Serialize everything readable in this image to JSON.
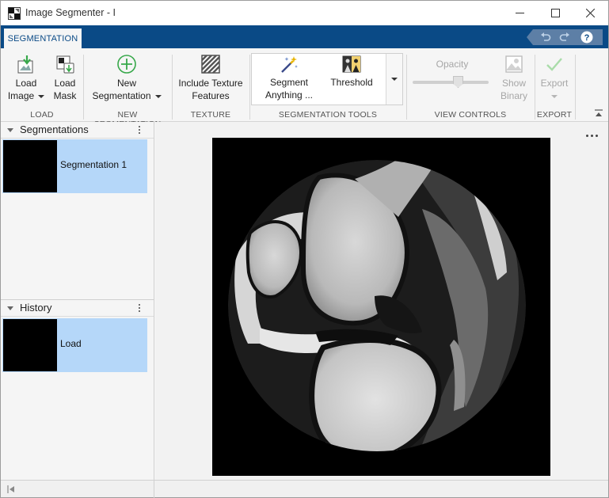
{
  "window": {
    "title": "Image Segmenter - I",
    "icon": "matlab-app-icon",
    "controls": [
      "minimize-icon",
      "maximize-icon",
      "close-icon"
    ]
  },
  "tabs": [
    {
      "label": "SEGMENTATION",
      "active": true
    }
  ],
  "quick_access": [
    "undo-icon",
    "redo-icon",
    "help-icon"
  ],
  "ribbon": {
    "load": {
      "group_label": "LOAD",
      "load_image": {
        "line1": "Load",
        "line2": "Image",
        "icon": "load-image-icon"
      },
      "load_mask": {
        "line1": "Load",
        "line2": "Mask",
        "icon": "load-mask-icon"
      }
    },
    "new_segmentation": {
      "group_label": "NEW SEGMENTATION",
      "button": {
        "line1": "New",
        "line2": "Segmentation",
        "icon": "plus-circle-icon"
      }
    },
    "texture": {
      "group_label": "TEXTURE",
      "button": {
        "line1": "Include Texture",
        "line2": "Features",
        "icon": "texture-icon"
      }
    },
    "segmentation_tools": {
      "group_label": "SEGMENTATION TOOLS",
      "segment_anything": {
        "line1": "Segment",
        "line2": "Anything ...",
        "icon": "magic-wand-icon"
      },
      "threshold": {
        "line1": "Threshold",
        "icon": "threshold-icon"
      }
    },
    "view_controls": {
      "group_label": "VIEW CONTROLS",
      "opacity_label": "Opacity",
      "opacity_value": 0.6,
      "show_binary": {
        "line1": "Show",
        "line2": "Binary",
        "icon": "show-binary-icon",
        "enabled": false
      }
    },
    "export": {
      "group_label": "EXPORT",
      "button": {
        "line1": "Export",
        "icon": "export-check-icon",
        "enabled": false
      }
    }
  },
  "panels": {
    "segmentations": {
      "title": "Segmentations",
      "items": [
        {
          "label": "Segmentation 1",
          "selected": true
        }
      ]
    },
    "history": {
      "title": "History",
      "items": [
        {
          "label": "Load",
          "selected": true
        }
      ]
    }
  },
  "colors": {
    "ribbon_blue": "#0a4a86",
    "selection_blue": "#b5d7f9",
    "accent_green": "#37a84a"
  }
}
